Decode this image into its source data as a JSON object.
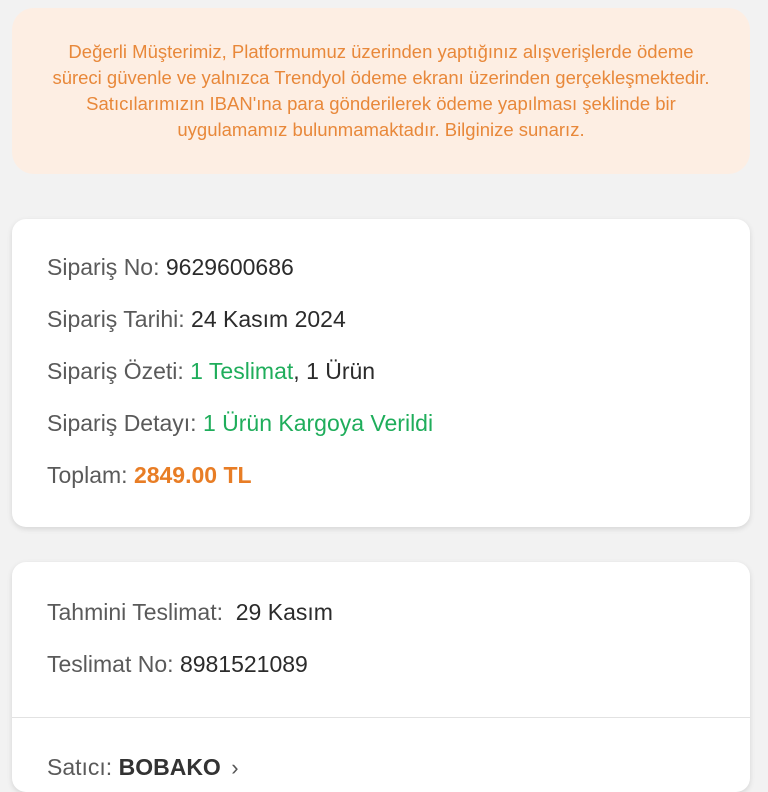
{
  "notice": {
    "text": "Değerli Müşterimiz, Platformumuz üzerinden yaptığınız alışverişlerde ödeme süreci güvenle ve yalnızca Trendyol ödeme ekranı üzerinden gerçekleşmektedir. Satıcılarımızın IBAN'ına para gönderilerek ödeme yapılması şeklinde bir uygulamamız bulunmamaktadır. Bilginize sunarız."
  },
  "order": {
    "no_label": "Sipariş No:",
    "no_value": "9629600686",
    "date_label": "Sipariş Tarihi:",
    "date_value": "24 Kasım 2024",
    "summary_label": "Sipariş Özeti:",
    "summary_delivery": "1 Teslimat",
    "summary_sep": ", ",
    "summary_items": "1 Ürün",
    "detail_label": "Sipariş Detayı:",
    "detail_value": "1 Ürün Kargoya Verildi",
    "total_label": "Toplam:",
    "total_value": "2849.00 TL"
  },
  "delivery": {
    "estimated_label": "Tahmini Teslimat:",
    "estimated_value": "29 Kasım",
    "no_label": "Teslimat No:",
    "no_value": "8981521089",
    "seller_label": "Satıcı:",
    "seller_name": "BOBAKO",
    "chevron_icon": "chevron-right-icon"
  },
  "colors": {
    "notice_bg": "#fdeee3",
    "notice_text": "#e8883a",
    "green": "#1fad5b",
    "orange": "#e87d25"
  }
}
